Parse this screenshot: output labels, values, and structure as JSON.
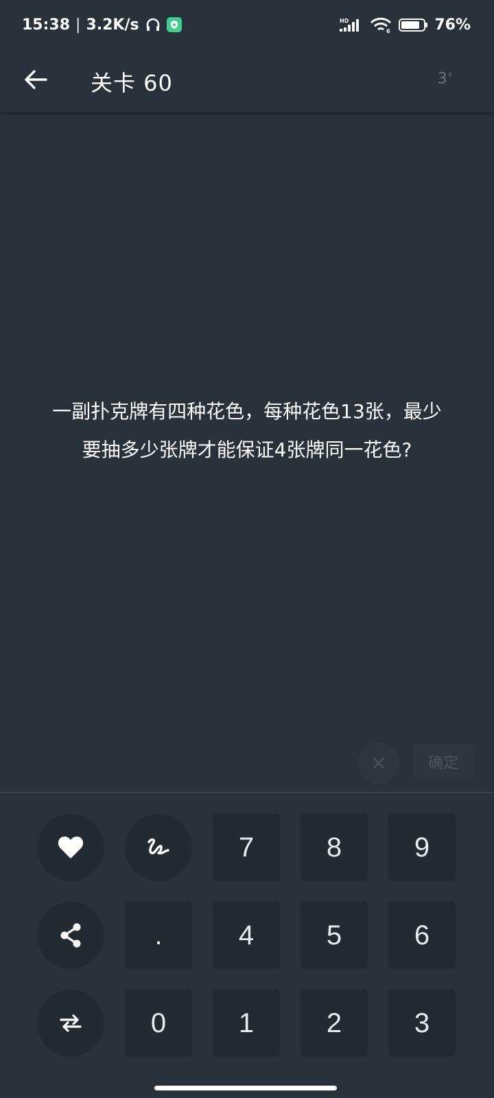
{
  "status_bar": {
    "time": "15:38",
    "separator": "|",
    "net_speed": "3.2K/s",
    "battery": "76%"
  },
  "app_bar": {
    "title": "关卡 60",
    "hint_count": "3"
  },
  "question": {
    "line1": "一副扑克牌有四种花色，每种花色13张，最少",
    "line2": "要抽多少张牌才能保证4张牌同一花色?"
  },
  "answer": {
    "confirm_label": "确定"
  },
  "keypad": {
    "k7": "7",
    "k8": "8",
    "k9": "9",
    "dot": ".",
    "k4": "4",
    "k5": "5",
    "k6": "6",
    "k0": "0",
    "k1": "1",
    "k2": "2",
    "k3": "3"
  },
  "colors": {
    "background": "#29323a",
    "key_background": "#222b32",
    "disabled_text": "#4a555e"
  }
}
